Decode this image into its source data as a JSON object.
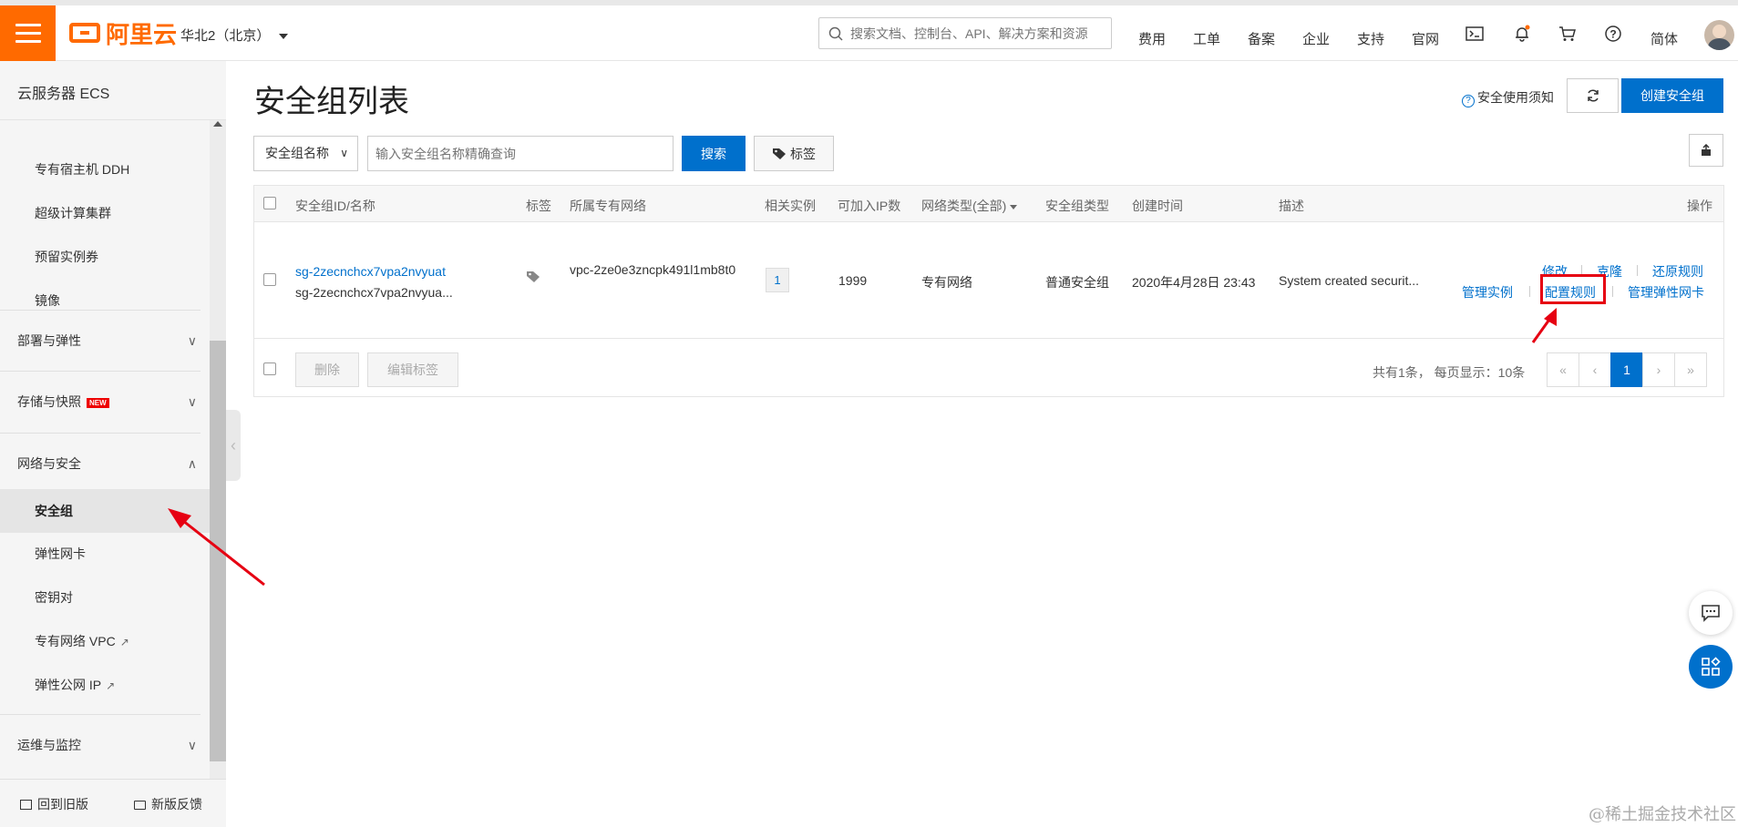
{
  "header": {
    "logo_text": "阿里云",
    "region": "华北2（北京）",
    "search_placeholder": "搜索文档、控制台、API、解决方案和资源",
    "nav": [
      "费用",
      "工单",
      "备案",
      "企业",
      "支持",
      "官网"
    ],
    "lang": "简体",
    "accent_color": "#ff6a00",
    "icons": [
      "terminal-icon",
      "bell-icon",
      "cart-icon",
      "help-icon"
    ]
  },
  "sidebar": {
    "title": "云服务器 ECS",
    "items_top": [
      "专有宿主机 DDH",
      "超级计算集群",
      "预留实例券",
      "镜像"
    ],
    "groups": {
      "deploy": "部署与弹性",
      "storage": "存储与快照",
      "storage_badge": "NEW",
      "network": "网络与安全",
      "ops": "运维与监控"
    },
    "network_items": [
      "安全组",
      "弹性网卡",
      "密钥对",
      "专有网络 VPC",
      "弹性公网 IP"
    ],
    "active_item": "安全组",
    "bottom": {
      "old_version": "回到旧版",
      "feedback": "新版反馈"
    }
  },
  "main": {
    "title": "安全组列表",
    "notice": "安全使用须知",
    "create_button": "创建安全组",
    "filter_select": "安全组名称",
    "filter_placeholder": "输入安全组名称精确查询",
    "search_button": "搜索",
    "tag_button": "标签",
    "table": {
      "headers": [
        "安全组ID/名称",
        "标签",
        "所属专有网络",
        "相关实例",
        "可加入IP数",
        "网络类型(全部)",
        "安全组类型",
        "创建时间",
        "描述",
        "操作"
      ],
      "rows": [
        {
          "id": "sg-2zecnchcx7vpa2nvyuat",
          "name": "sg-2zecnchcx7vpa2nvyua...",
          "vpc": "vpc-2ze0e3zncpk491l1mb8t0",
          "instances": "1",
          "ip_count": "1999",
          "network_type": "专有网络",
          "sg_type": "普通安全组",
          "created": "2020年4月28日 23:43",
          "desc": "System created securit...",
          "ops": {
            "modify": "修改",
            "clone": "克隆",
            "restore": "还原规则",
            "manage_instances": "管理实例",
            "config_rules": "配置规则",
            "manage_eni": "管理弹性网卡"
          }
        }
      ]
    },
    "footer": {
      "delete": "删除",
      "edit_tags": "编辑标签",
      "summary": "共有1条， 每页显示：10条",
      "pages": [
        "«",
        "‹",
        "1",
        "›",
        "»"
      ],
      "current_page": "1"
    }
  },
  "watermark": "@稀土掘金技术社区"
}
